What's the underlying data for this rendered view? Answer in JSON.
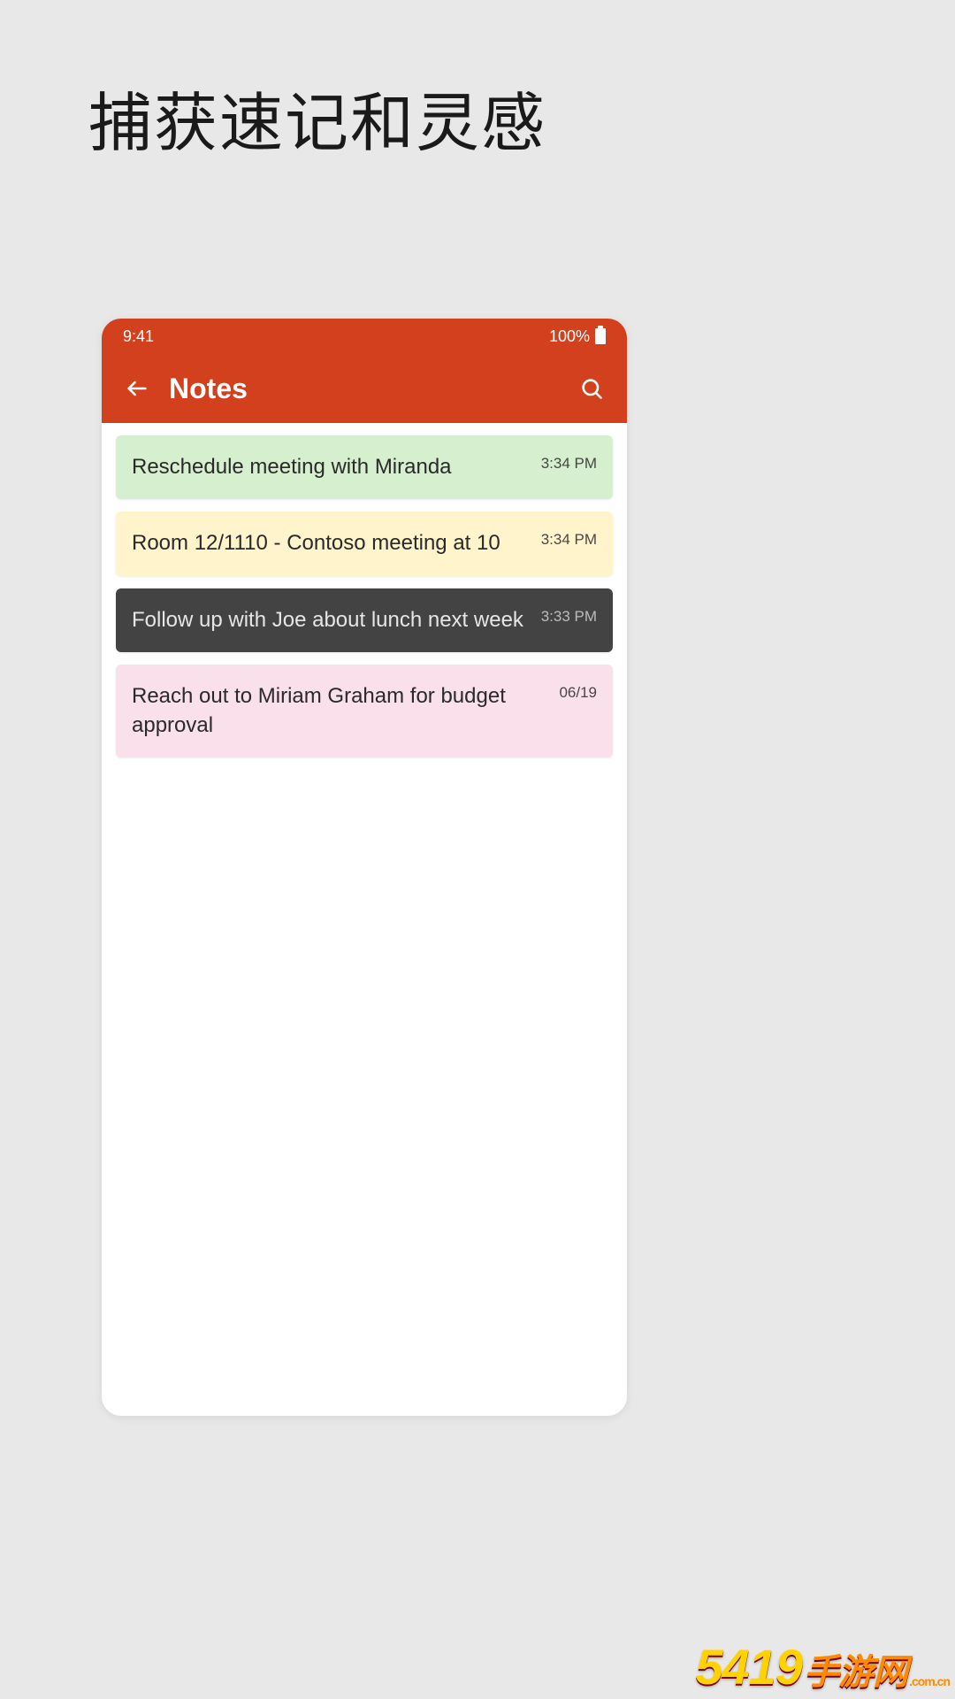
{
  "headline": "捕获速记和灵感",
  "statusbar": {
    "time": "9:41",
    "battery": "100%"
  },
  "appbar": {
    "title": "Notes"
  },
  "notes": [
    {
      "text": "Reschedule meeting with Miranda",
      "time": "3:34 PM",
      "color": "green"
    },
    {
      "text": "Room 12/1110 - Contoso meeting at 10",
      "time": "3:34 PM",
      "color": "yellow"
    },
    {
      "text": "Follow up with Joe about lunch next week",
      "time": "3:33 PM",
      "color": "dark"
    },
    {
      "text": "Reach out to Miriam Graham for budget approval",
      "time": "06/19",
      "color": "pink"
    }
  ],
  "watermark": {
    "main": "5419",
    "mid": "手游网",
    "sub": ".com.cn"
  }
}
